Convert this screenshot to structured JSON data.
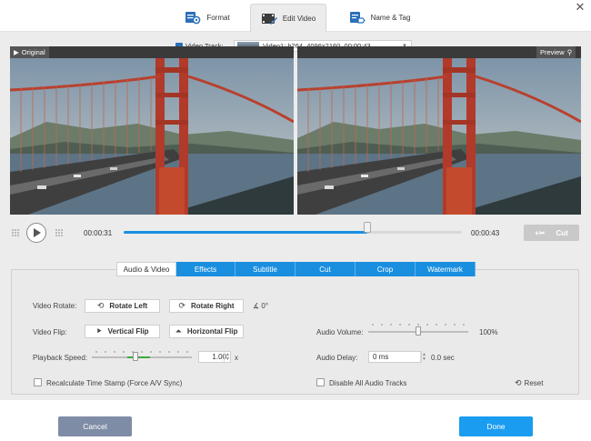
{
  "tabs": [
    {
      "label": "Format",
      "icon": "format-gear-icon"
    },
    {
      "label": "Edit Video",
      "icon": "film-edit-icon",
      "active": true
    },
    {
      "label": "Name & Tag",
      "icon": "tag-icon"
    }
  ],
  "video_track": {
    "label": "Video Track:",
    "selected": "Video1: h264, 4096x2160, 00:00:43"
  },
  "panes": {
    "original_label": "Original",
    "preview_label": "Preview"
  },
  "player": {
    "current_time": "00:00:31",
    "end_time": "00:00:43",
    "progress": 0.72,
    "cut_label": "Cut"
  },
  "subtabs": [
    "Audio & Video",
    "Effects",
    "Subtitle",
    "Cut",
    "Crop",
    "Watermark"
  ],
  "settings": {
    "rotate_label": "Video Rotate:",
    "rotate_left": "Rotate Left",
    "rotate_right": "Rotate Right",
    "angle": "0°",
    "flip_label": "Video Flip:",
    "vertical_flip": "Vertical Flip",
    "horizontal_flip": "Horizontal Flip",
    "speed_label": "Playback Speed:",
    "speed_value": "1.00",
    "speed_unit": "x",
    "recalc_label": "Recalculate Time Stamp (Force A/V Sync)",
    "volume_label": "Audio Volume:",
    "volume_value": "100%",
    "volume_level": 0.5,
    "delay_label": "Audio Delay:",
    "delay_value": "0 ms",
    "delay_sec": "0.0 sec",
    "disable_audio_label": "Disable All Audio Tracks",
    "reset_label": "Reset"
  },
  "footer": {
    "cancel": "Cancel",
    "done": "Done"
  },
  "colors": {
    "accent": "#1a8fe0",
    "done": "#1a9cf0",
    "cancel": "#7f8ca6"
  }
}
